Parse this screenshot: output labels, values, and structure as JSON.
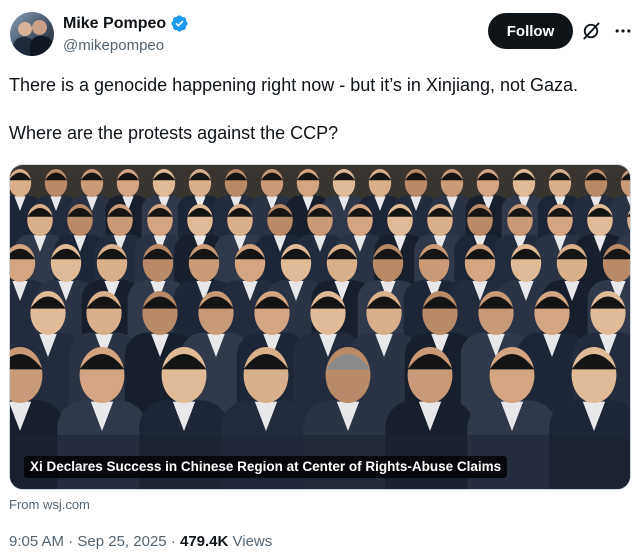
{
  "author": {
    "display_name": "Mike Pompeo",
    "handle": "@mikepompeo",
    "verified": true
  },
  "actions": {
    "follow_label": "Follow"
  },
  "tweet": {
    "line1": "There is a genocide happening right now - but it’s in Xinjiang, not Gaza.",
    "line2": "Where are the protests against the CCP?"
  },
  "media": {
    "caption": "Xi Declares Success in Chinese Region at Center of Rights-Abuse Claims",
    "source": "From wsj.com"
  },
  "meta": {
    "time": "9:05 AM",
    "sep1": " · ",
    "date": "Sep 25, 2025",
    "sep2": " · ",
    "views_count": "479.4K",
    "views_label": " Views"
  },
  "colors": {
    "verified": "#1d9bf0",
    "secondary_text": "#536471",
    "primary_text": "#0f1419"
  },
  "icons": [
    "verified-badge-icon",
    "grok-icon",
    "more-options-icon"
  ]
}
